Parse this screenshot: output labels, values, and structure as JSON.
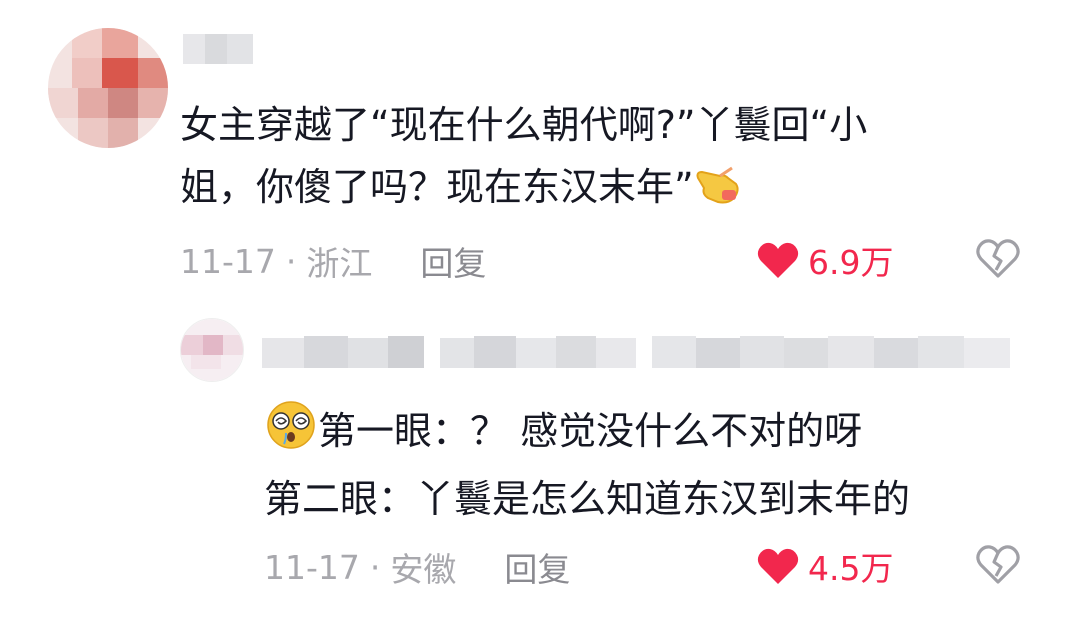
{
  "comment1": {
    "text_line1": "女主穿越了“现在什么朝代啊?”丫鬟回“小",
    "text_line2": "姐，你傻了吗？现在东汉末年”",
    "trailing_emoji": "pointing-hand-emoji",
    "date": "11-17",
    "separator": "·",
    "location": "浙江",
    "reply_label": "回复",
    "likes": "6.9万"
  },
  "comment2": {
    "leading_emoji": "dizzy-face-emoji",
    "text_line1": "第一眼：？ 感觉没什么不对的呀",
    "text_line2": "第二眼：丫鬟是怎么知道东汉到末年的",
    "date": "11-17",
    "separator": "·",
    "location": "安徽",
    "reply_label": "回复",
    "likes": "4.5万"
  },
  "colors": {
    "like_red": "#f2274d",
    "meta_gray": "#a8a8ad",
    "text": "#161823"
  },
  "icons": [
    "heart-filled-icon",
    "broken-heart-icon"
  ]
}
